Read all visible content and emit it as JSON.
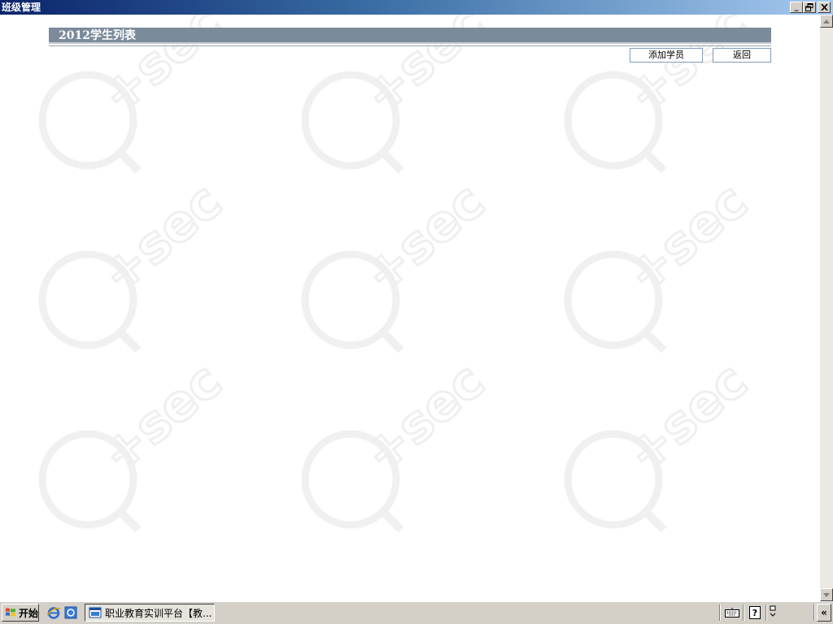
{
  "window": {
    "title": "班级管理",
    "controls": {
      "minimize": "_",
      "restore": "🗗",
      "close": "✕"
    }
  },
  "panel": {
    "title": "2012学生列表",
    "actions": {
      "add_label": "添加学员",
      "back_label": "返回"
    }
  },
  "watermark": {
    "text": "Q-sec"
  },
  "taskbar": {
    "start_label": "开始",
    "quick_launch": [
      "ie-icon",
      "desktop-icon"
    ],
    "tasks": [
      {
        "label": "职业教育实训平台【教...",
        "icon": "app-window-icon"
      }
    ],
    "tray": [
      "keyboard-icon",
      "help-icon",
      "ime-icon"
    ],
    "expand_label": "«"
  },
  "colors": {
    "panel_header": "#7b8b9b",
    "titlebar_start": "#0a246a",
    "titlebar_end": "#a6caf0",
    "taskbar": "#d4d0c8"
  }
}
